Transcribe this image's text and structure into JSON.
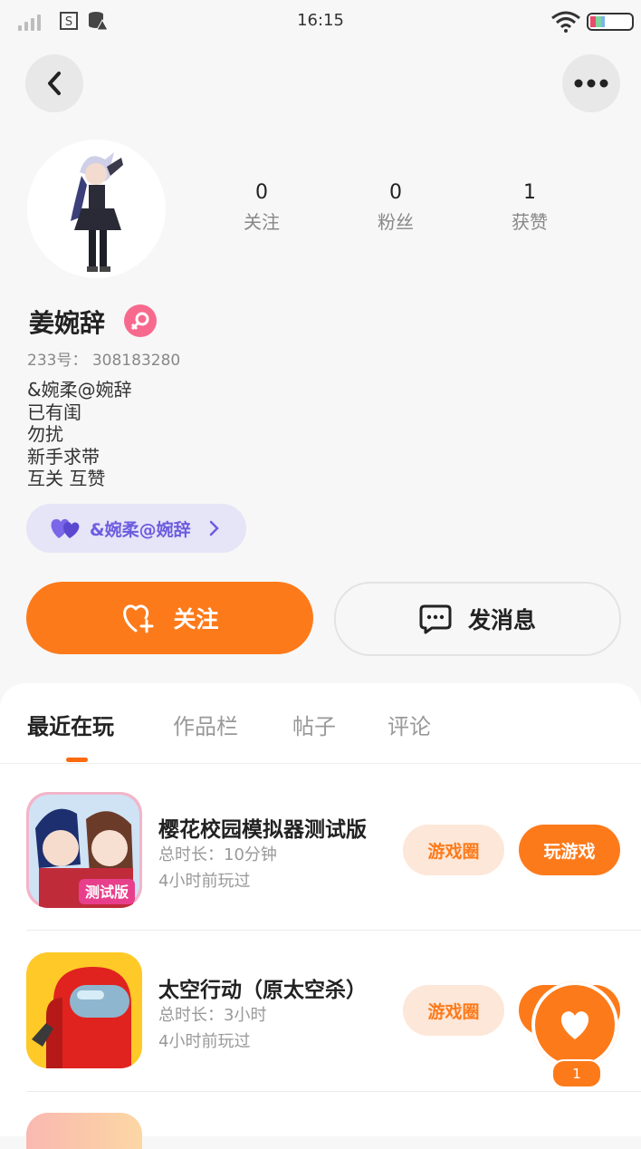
{
  "status_bar": {
    "time": "16:15"
  },
  "profile": {
    "username": "姜婉辞",
    "uid_label": "233号：",
    "uid_value": "308183280",
    "bio_lines": [
      "&婉柔@婉辞",
      "已有闺",
      "勿扰",
      "新手求带",
      "互关 互赞"
    ],
    "tag_label": "&婉柔@婉辞",
    "stats": [
      {
        "value": "0",
        "label": "关注"
      },
      {
        "value": "0",
        "label": "粉丝"
      },
      {
        "value": "1",
        "label": "获赞"
      }
    ]
  },
  "actions": {
    "follow_label": "关注",
    "message_label": "发消息"
  },
  "tabs": [
    "最近在玩",
    "作品栏",
    "帖子",
    "评论"
  ],
  "games": [
    {
      "name": "樱花校园模拟器测试版",
      "total_time": "总时长：10分钟",
      "last_played": "4小时前玩过",
      "circle_label": "游戏圈",
      "play_label": "玩游戏",
      "icon_badge": "测试版"
    },
    {
      "name": "太空行动（原太空杀）",
      "total_time": "总时长：3小时",
      "last_played": "4小时前玩过",
      "circle_label": "游戏圈",
      "play_label": "玩游戏"
    }
  ],
  "like_fab": {
    "count": "1"
  },
  "colors": {
    "accent": "#fd7a1a",
    "accent_light": "#fde7d8",
    "tag_bg": "#e6e4f7",
    "tag_text": "#6c5de0",
    "female": "#f76a8e"
  }
}
